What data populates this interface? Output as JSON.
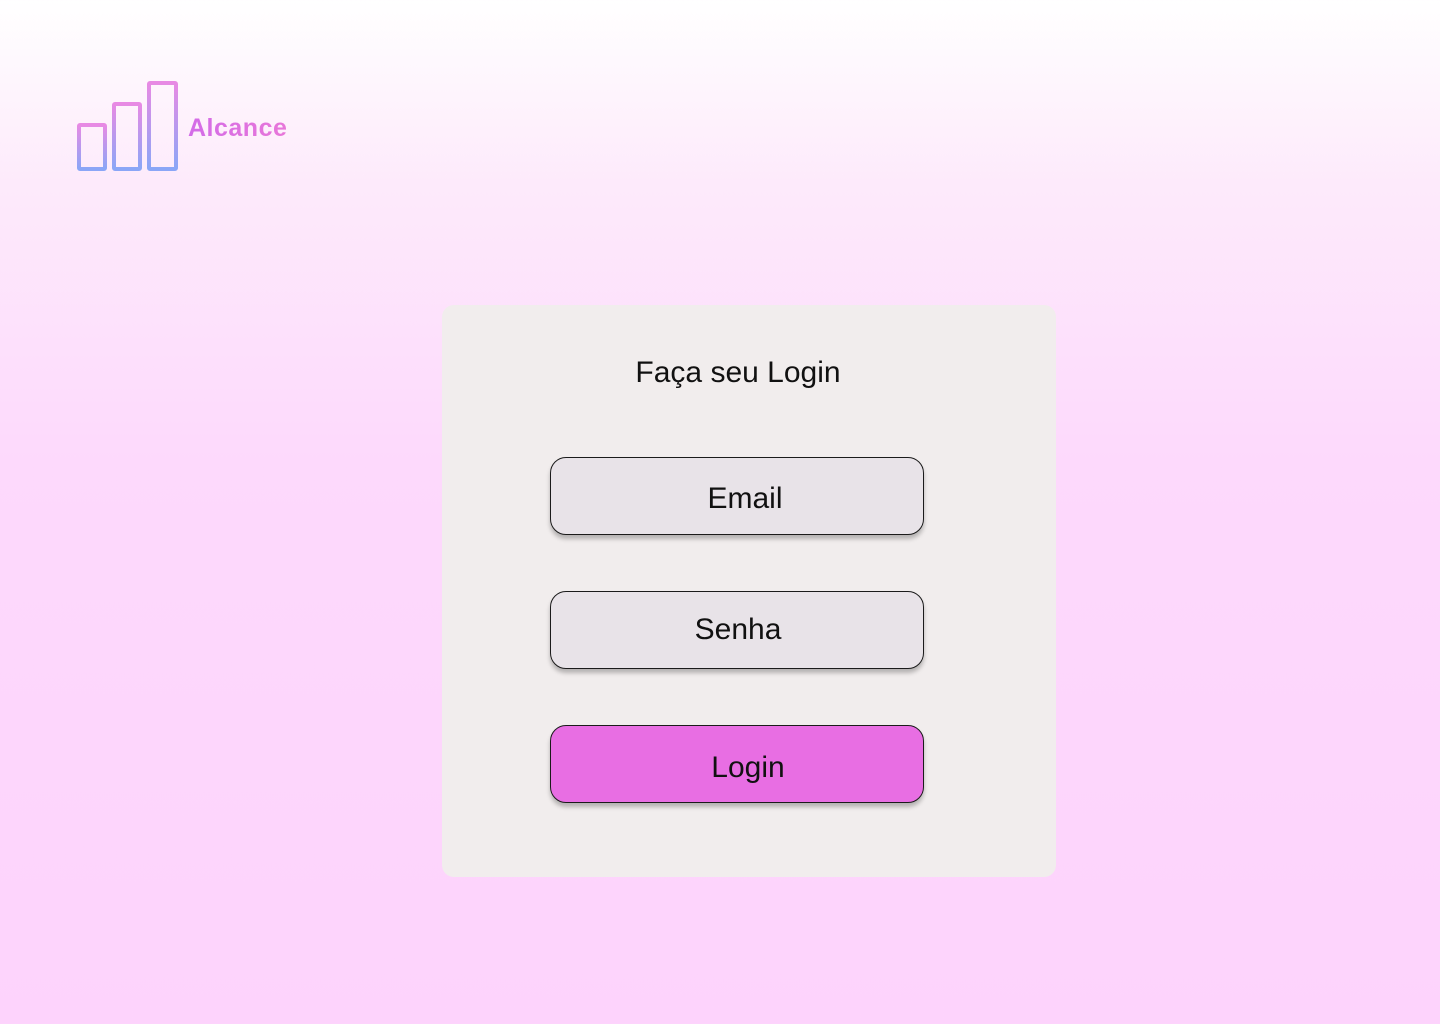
{
  "brand": {
    "name": "Alcance",
    "logo_icon": "bar-chart-logo-icon"
  },
  "login": {
    "title": "Faça seu Login",
    "email_placeholder": "Email",
    "password_placeholder": "Senha",
    "button_label": "Login"
  },
  "colors": {
    "accent": "#e86ee3",
    "card": "#f1eded",
    "field": "#e8e3e8",
    "logo_gradient_start": "#8aa6f7",
    "logo_gradient_end": "#e88ae4"
  }
}
